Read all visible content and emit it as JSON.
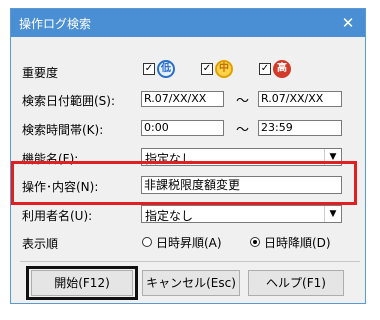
{
  "window": {
    "title": "操作ログ検索",
    "close_glyph": "✕"
  },
  "priority": {
    "label": "重要度",
    "items": [
      {
        "checked": true,
        "badge": "低",
        "color": "#2a6fc9"
      },
      {
        "checked": true,
        "badge": "中",
        "color": "#e0a000"
      },
      {
        "checked": true,
        "badge": "高",
        "color": "#d43a2a"
      }
    ]
  },
  "date_range": {
    "label": "検索日付範囲(S):",
    "from": "R.07/XX/XX",
    "to": "R.07/XX/XX",
    "sep": "～"
  },
  "time_range": {
    "label": "検索時間帯(K):",
    "from": "0:00",
    "to": "23:59",
    "sep": "～"
  },
  "function_name": {
    "label": "機能名(F):",
    "value": "指定なし"
  },
  "operation": {
    "label": "操作･内容(N):",
    "value": "非課税限度額変更"
  },
  "user_name": {
    "label": "利用者名(U):",
    "value": "指定なし"
  },
  "sort_order": {
    "label": "表示順",
    "options": [
      {
        "label": "日時昇順(A)",
        "selected": false
      },
      {
        "label": "日時降順(D)",
        "selected": true
      }
    ]
  },
  "buttons": {
    "start": "開始(F12)",
    "cancel": "キャンセル(Esc)",
    "help": "ヘルプ(F1)"
  }
}
